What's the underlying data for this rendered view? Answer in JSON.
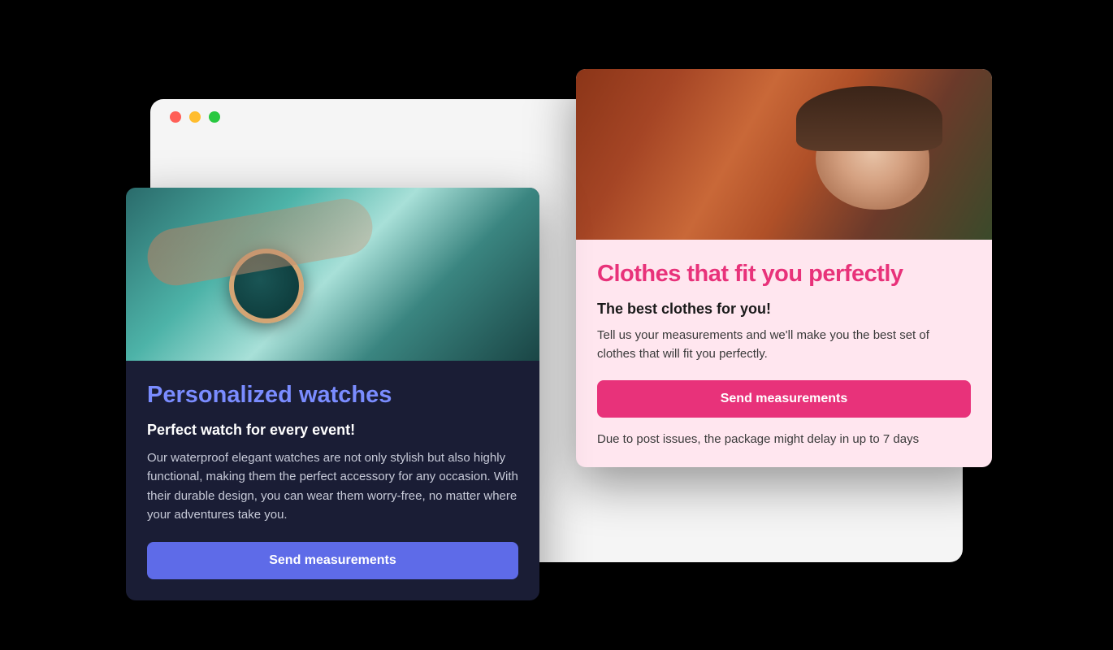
{
  "cards": {
    "watches": {
      "title": "Personalized watches",
      "subtitle": "Perfect watch for every event!",
      "description": "Our waterproof elegant watches are not only stylish but also highly functional, making them the perfect accessory for any occasion. With their durable design, you can wear them worry-free, no matter where your adventures take you.",
      "button_label": "Send measurements"
    },
    "clothes": {
      "title": "Clothes that fit you perfectly",
      "subtitle": "The best clothes for you!",
      "description": "Tell us your measurements and we'll make you the best set of clothes that will fit you perfectly.",
      "button_label": "Send measurements",
      "note": "Due to post issues, the package might delay in up to 7 days"
    }
  }
}
